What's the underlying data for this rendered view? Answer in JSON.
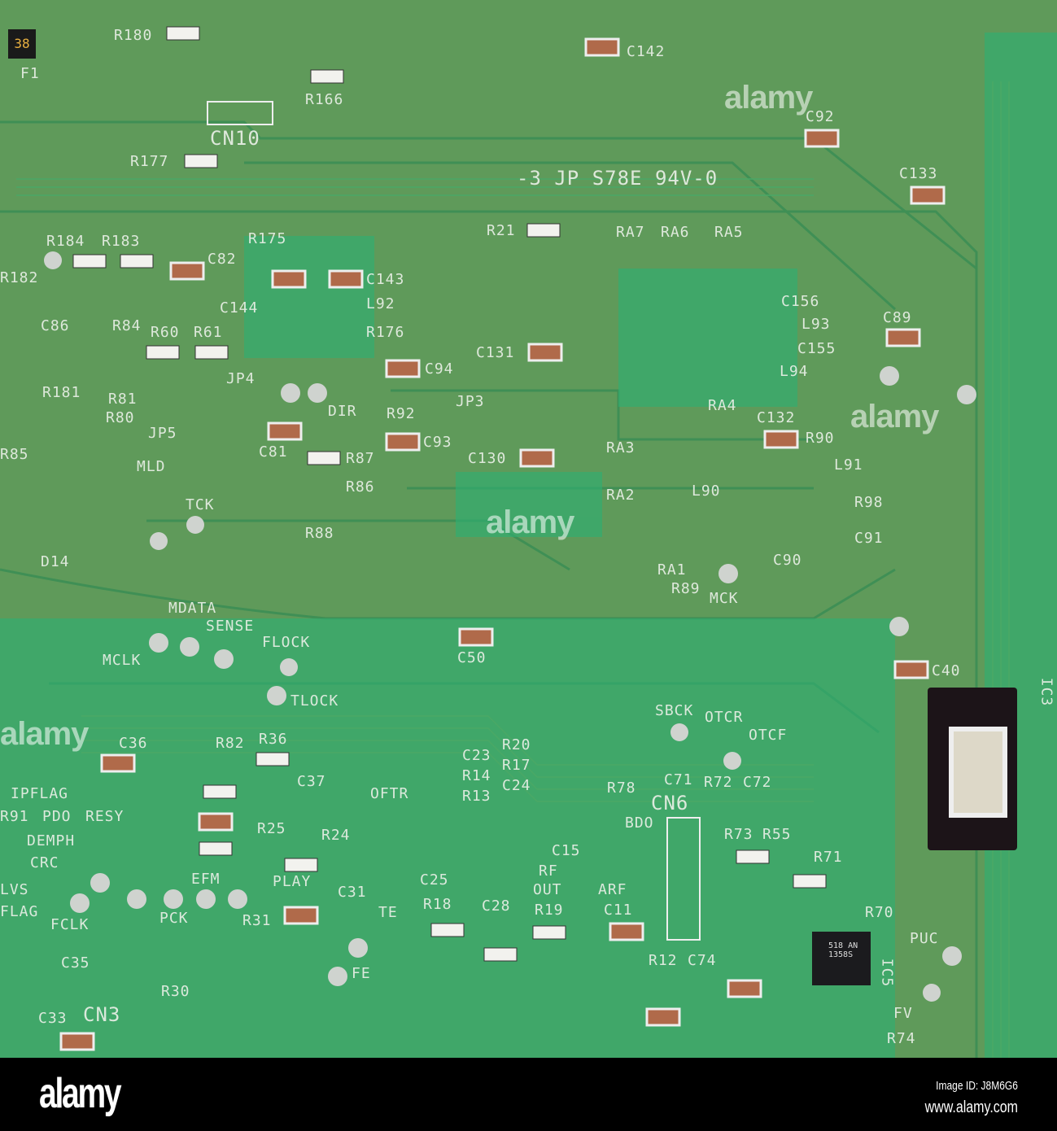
{
  "board_labels": {
    "fuse_code": "38",
    "f1": "F1",
    "r180": "R180",
    "r166": "R166",
    "cn10": "CN10",
    "r177": "R177",
    "c142": "C142",
    "c92": "C92",
    "c133": "C133",
    "board_marking": "-3  JP S78E  94V-0",
    "r21": "R21",
    "ra7": "RA7",
    "ra6": "RA6",
    "ra5": "RA5",
    "r184": "R184",
    "r183": "R183",
    "r175": "R175",
    "c82": "C82",
    "c143": "C143",
    "l92": "L92",
    "r182": "R182",
    "c144": "C144",
    "r176": "R176",
    "c86": "C86",
    "r84": "R84",
    "r60": "R60",
    "r61": "R61",
    "c156": "C156",
    "l93": "L93",
    "c155": "C155",
    "c89": "C89",
    "c131": "C131",
    "c94": "C94",
    "l94": "L94",
    "jp4": "JP4",
    "r181": "R181",
    "r81": "R81",
    "r80": "R80",
    "jp5": "JP5",
    "dir": "DIR",
    "jp3": "JP3",
    "r92": "R92",
    "ra4": "RA4",
    "c132": "C132",
    "r90": "R90",
    "r85": "R85",
    "c81": "C81",
    "c93": "C93",
    "r87": "R87",
    "c130": "C130",
    "ra3": "RA3",
    "l91": "L91",
    "mld": "MLD",
    "r86": "R86",
    "ra2": "RA2",
    "l90": "L90",
    "r98": "R98",
    "tck": "TCK",
    "r88": "R88",
    "c91": "C91",
    "c90": "C90",
    "d14": "D14",
    "ra1": "RA1",
    "r89": "R89",
    "mck": "MCK",
    "mdata": "MDATA",
    "sense": "SENSE",
    "flock": "FLOCK",
    "mclk": "MCLK",
    "c50": "C50",
    "c40": "C40",
    "tlock": "TLOCK",
    "sbck": "SBCK",
    "otcr": "OTCR",
    "otcf": "OTCF",
    "ic3": "IC3",
    "c36": "C36",
    "r82": "R82",
    "r36": "R36",
    "c23": "C23",
    "r20": "R20",
    "r14": "R14",
    "r17": "R17",
    "r13": "R13",
    "c24": "C24",
    "c71": "C71",
    "r72": "R72",
    "c72": "C72",
    "ipflag": "IPFLAG",
    "c37": "C37",
    "oftr": "OFTR",
    "r78": "R78",
    "cn6": "CN6",
    "r91": "R91",
    "pdo": "PDO",
    "resy": "RESY",
    "r25": "R25",
    "bdo": "BDO",
    "r73": "R73",
    "r55": "R55",
    "demph": "DEMPH",
    "r24": "R24",
    "crc": "CRC",
    "c15": "C15",
    "r71": "R71",
    "lvs": "LVS",
    "efm": "EFM",
    "play": "PLAY",
    "c25": "C25",
    "rf": "RF",
    "out": "OUT",
    "arf": "ARF",
    "flag": "FLAG",
    "c31": "C31",
    "r18": "R18",
    "c28": "C28",
    "r19": "R19",
    "c11": "C11",
    "r70": "R70",
    "fclk": "FCLK",
    "pck": "PCK",
    "r31": "R31",
    "te": "TE",
    "puc": "PUC",
    "c35": "C35",
    "r12": "R12",
    "c74": "C74",
    "ic5": "IC5",
    "fe": "FE",
    "r30": "R30",
    "fv": "FV",
    "cn3": "CN3",
    "c33": "C33",
    "r74": "R74",
    "ic5_marking": "518 AN 1358S"
  },
  "watermark": {
    "overlay": "alamy",
    "logo": "alamy",
    "image_id": "Image ID: J8M6G6",
    "site": "www.alamy.com"
  },
  "colors": {
    "board": "#5f9a5a",
    "trace": "#3f8f55",
    "solder_mask_bright": "#2fae72",
    "silkscreen": "#e9efe6",
    "pad": "#cfd3cf"
  }
}
